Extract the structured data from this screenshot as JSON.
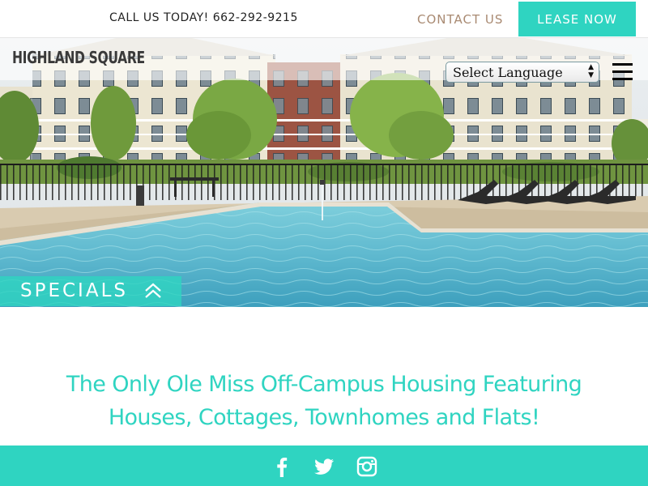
{
  "topbar": {
    "phone": "CALL US TODAY! 662-292-9215",
    "contact_label": "CONTACT US",
    "lease_label": "LEASE NOW"
  },
  "header": {
    "logo": "HIGHLAND SQUARE",
    "language_select": "Select Language",
    "menu_icon": "hamburger-menu-icon"
  },
  "hero": {
    "image": "apartment-pool-photo",
    "specials_label": "SPECIALS",
    "specials_icon": "double-chevron-up-icon"
  },
  "headline": {
    "line1": "The Only Ole Miss Off-Campus Housing Featuring",
    "line2": "Houses, Cottages, Townhomes and Flats!"
  },
  "footer": {
    "social": [
      {
        "icon": "facebook-icon"
      },
      {
        "icon": "twitter-icon"
      },
      {
        "icon": "instagram-icon"
      }
    ]
  },
  "colors": {
    "accent": "#2fd4c1",
    "contact_text": "#a98a72",
    "phone_text": "#222222",
    "logo_text": "#3a3a3a"
  }
}
